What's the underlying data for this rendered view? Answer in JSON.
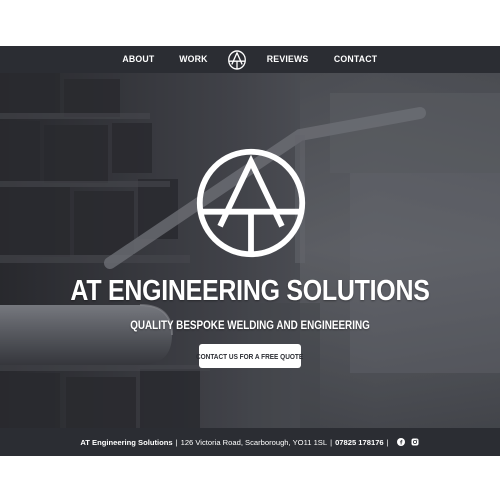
{
  "nav": {
    "items": [
      {
        "label": "ABOUT"
      },
      {
        "label": "WORK"
      },
      {
        "label": "REVIEWS"
      },
      {
        "label": "CONTACT"
      }
    ],
    "logo_icon": "at-monogram-icon"
  },
  "hero": {
    "logo_icon": "at-monogram-icon",
    "title": "AT ENGINEERING SOLUTIONS",
    "subtitle": "QUALITY BESPOKE WELDING AND ENGINEERING",
    "cta_label": "CONTACT US FOR A FREE QUOTE",
    "background": "brick wall with metal handrail, greyscale"
  },
  "footer": {
    "company": "AT Engineering Solutions",
    "address": "126 Victoria Road, Scarborough, YO11 1SL",
    "phone": "07825 178176",
    "separator": "|",
    "social_icons": [
      "facebook-icon",
      "instagram-icon"
    ]
  },
  "colors": {
    "nav_bg": "#2b2d33",
    "footer_bg": "#2b2d33",
    "text": "#ffffff",
    "cta_bg": "#ffffff",
    "cta_text": "#2b2d33"
  }
}
